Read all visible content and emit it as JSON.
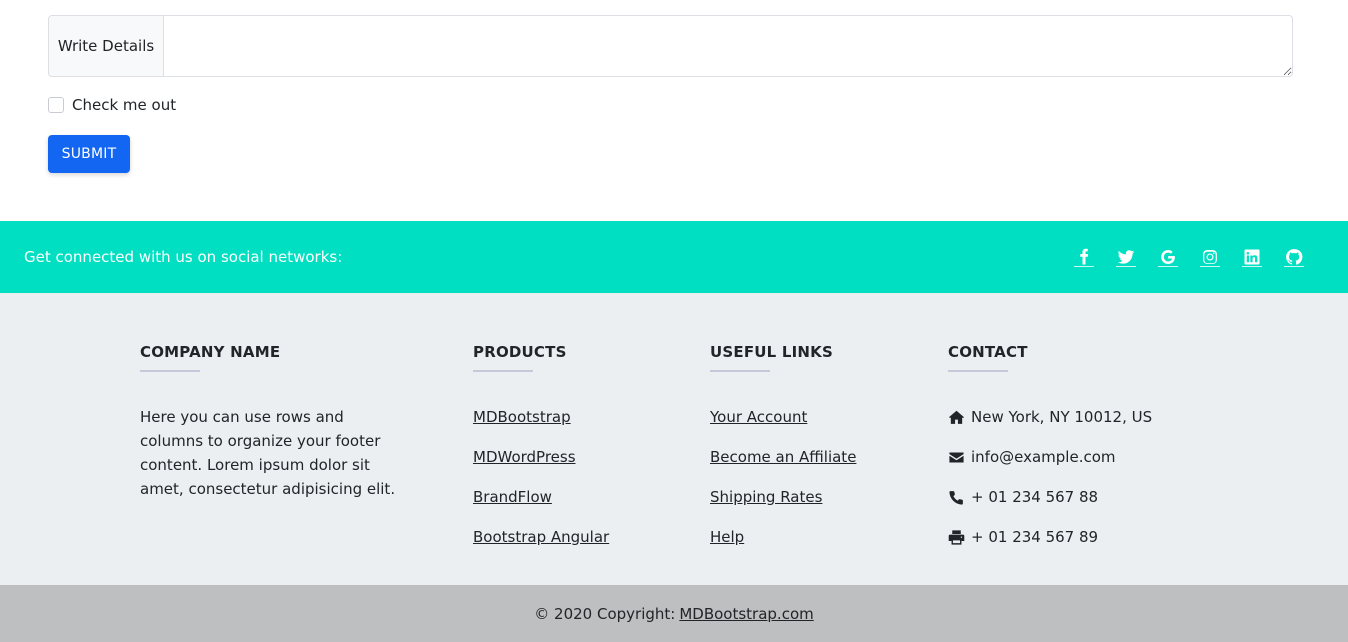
{
  "form": {
    "details_label": "Write Details",
    "details_value": "",
    "checkbox_label": "Check me out",
    "checkbox_checked": false,
    "submit_label": "SUBMIT"
  },
  "social": {
    "text": "Get connected with us on social networks:",
    "icons": [
      "facebook-icon",
      "twitter-icon",
      "google-icon",
      "instagram-icon",
      "linkedin-icon",
      "github-icon"
    ],
    "bar_color": "#00dfc1"
  },
  "footer": {
    "company": {
      "heading": "COMPANY NAME",
      "text": "Here you can use rows and columns to organize your footer content. Lorem ipsum dolor sit amet, consectetur adipisicing elit."
    },
    "products": {
      "heading": "PRODUCTS",
      "links": [
        "MDBootstrap",
        "MDWordPress",
        "BrandFlow",
        "Bootstrap Angular"
      ]
    },
    "useful_links": {
      "heading": "USEFUL LINKS",
      "links": [
        "Your Account",
        "Become an Affiliate",
        "Shipping Rates",
        "Help"
      ]
    },
    "contact": {
      "heading": "CONTACT",
      "items": [
        {
          "icon": "home-icon",
          "text": "New York, NY 10012, US"
        },
        {
          "icon": "envelope-icon",
          "text": "info@example.com"
        },
        {
          "icon": "phone-icon",
          "text": "+ 01 234 567 88"
        },
        {
          "icon": "print-icon",
          "text": "+ 01 234 567 89"
        }
      ]
    }
  },
  "copyright": {
    "prefix": "© 2020 Copyright:",
    "link": "MDBootstrap.com"
  },
  "colors": {
    "accent": "#1266f1",
    "footer_bg": "#eceff1",
    "copyright_bg": "#bdbfc1"
  }
}
